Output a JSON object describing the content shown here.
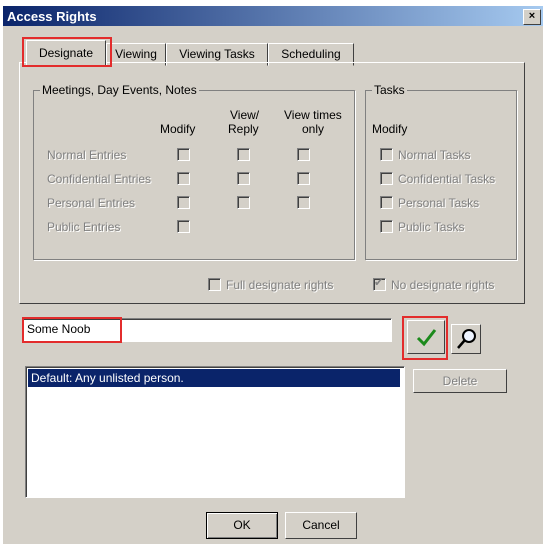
{
  "window": {
    "title": "Access Rights",
    "close_label": "×"
  },
  "tabs": [
    {
      "label": "Designate",
      "active": true
    },
    {
      "label": "Viewing"
    },
    {
      "label": "Viewing Tasks"
    },
    {
      "label": "Scheduling"
    }
  ],
  "meetings": {
    "title": "Meetings, Day Events, Notes",
    "col_modify": "Modify",
    "col_view_reply_1": "View/",
    "col_view_reply_2": "Reply",
    "col_view_times_1": "View times",
    "col_view_times_2": "only",
    "rows": [
      {
        "label": "Normal Entries"
      },
      {
        "label": "Confidential Entries"
      },
      {
        "label": "Personal Entries"
      },
      {
        "label": "Public Entries"
      }
    ]
  },
  "tasks": {
    "title": "Tasks",
    "col_modify": "Modify",
    "rows": [
      {
        "label": "Normal Tasks"
      },
      {
        "label": "Confidential Tasks"
      },
      {
        "label": "Personal Tasks"
      },
      {
        "label": "Public Tasks"
      }
    ]
  },
  "full_designate": {
    "label": "Full designate rights",
    "checked": false
  },
  "no_designate": {
    "label": "No designate rights",
    "checked": true
  },
  "name_input": {
    "value": "Some Noob"
  },
  "delete_label": "Delete",
  "list": {
    "items": [
      "Default: Any unlisted person."
    ]
  },
  "ok_label": "OK",
  "cancel_label": "Cancel",
  "colors": {
    "highlight": "#e32c2c",
    "selection": "#0a246a",
    "check_green": "#1c8a1c"
  }
}
